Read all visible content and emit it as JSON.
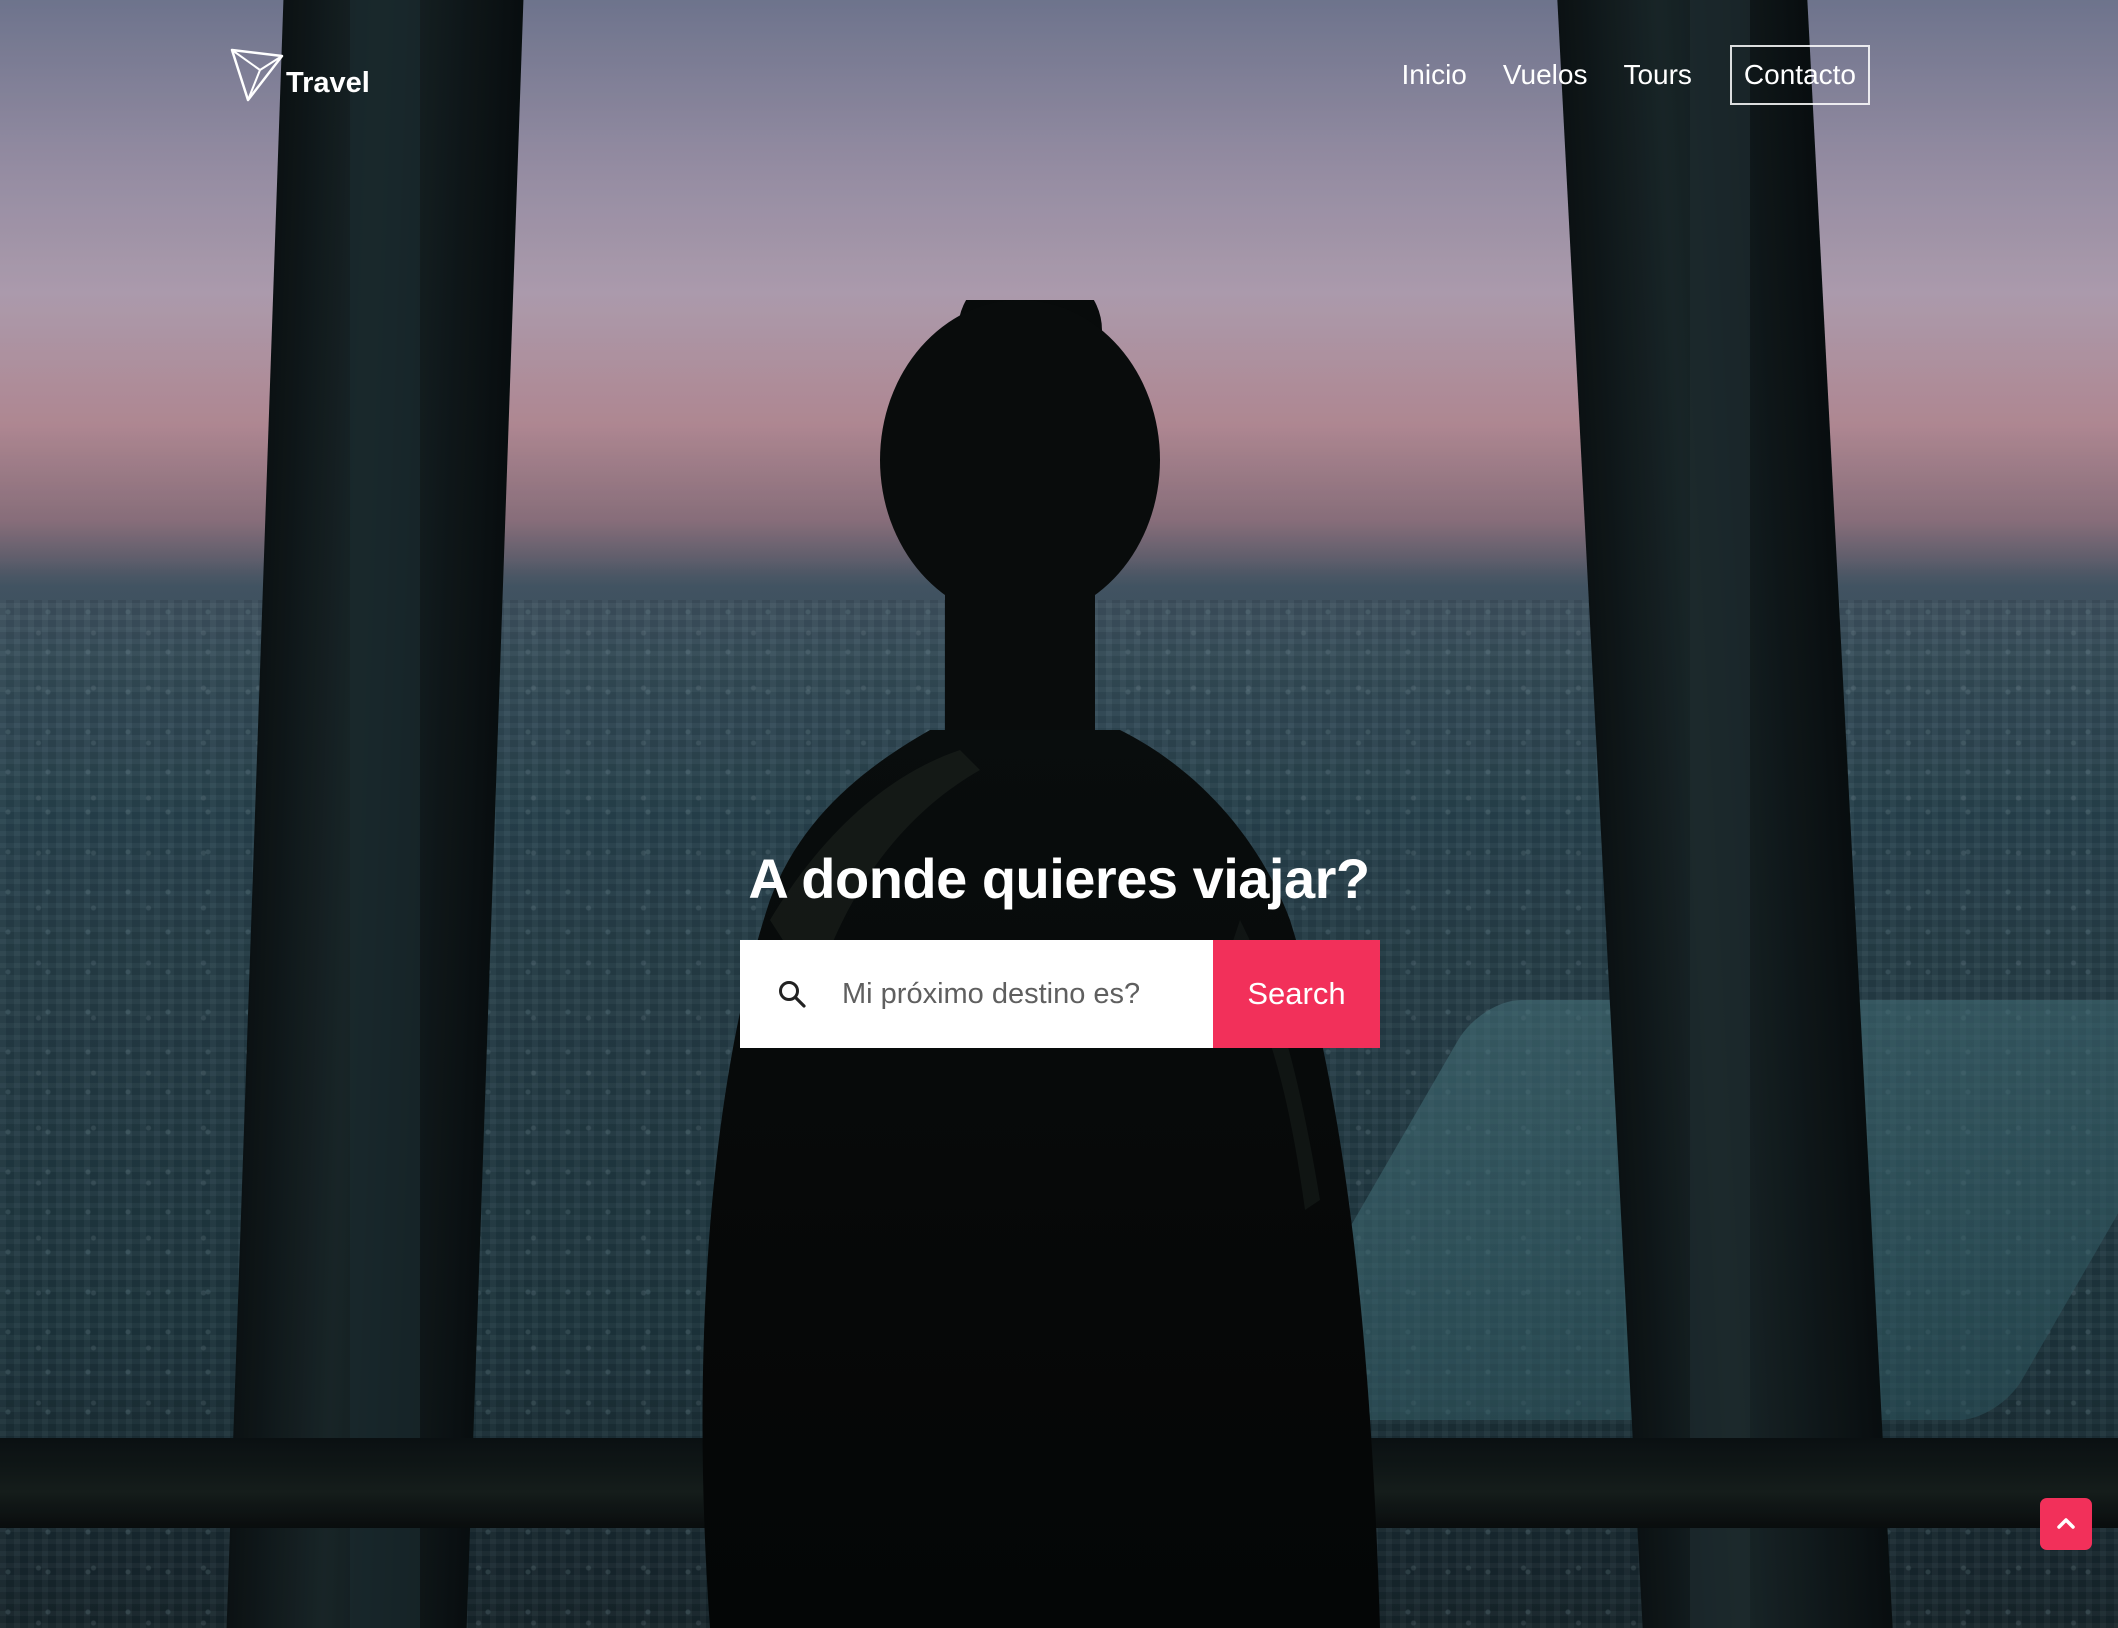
{
  "brand": {
    "name": "Travel",
    "logo_icon": "paper-plane-icon"
  },
  "nav": {
    "items": [
      {
        "label": "Inicio"
      },
      {
        "label": "Vuelos"
      },
      {
        "label": "Tours"
      },
      {
        "label": "Contacto",
        "boxed": true
      }
    ]
  },
  "hero": {
    "headline": "A donde quieres viajar?",
    "search": {
      "placeholder": "Mi próximo destino es?",
      "value": "",
      "button_label": "Search",
      "icon": "search-icon"
    }
  },
  "colors": {
    "accent": "#f2305a",
    "text": "#ffffff"
  },
  "scroll_top_icon": "chevron-up-icon"
}
